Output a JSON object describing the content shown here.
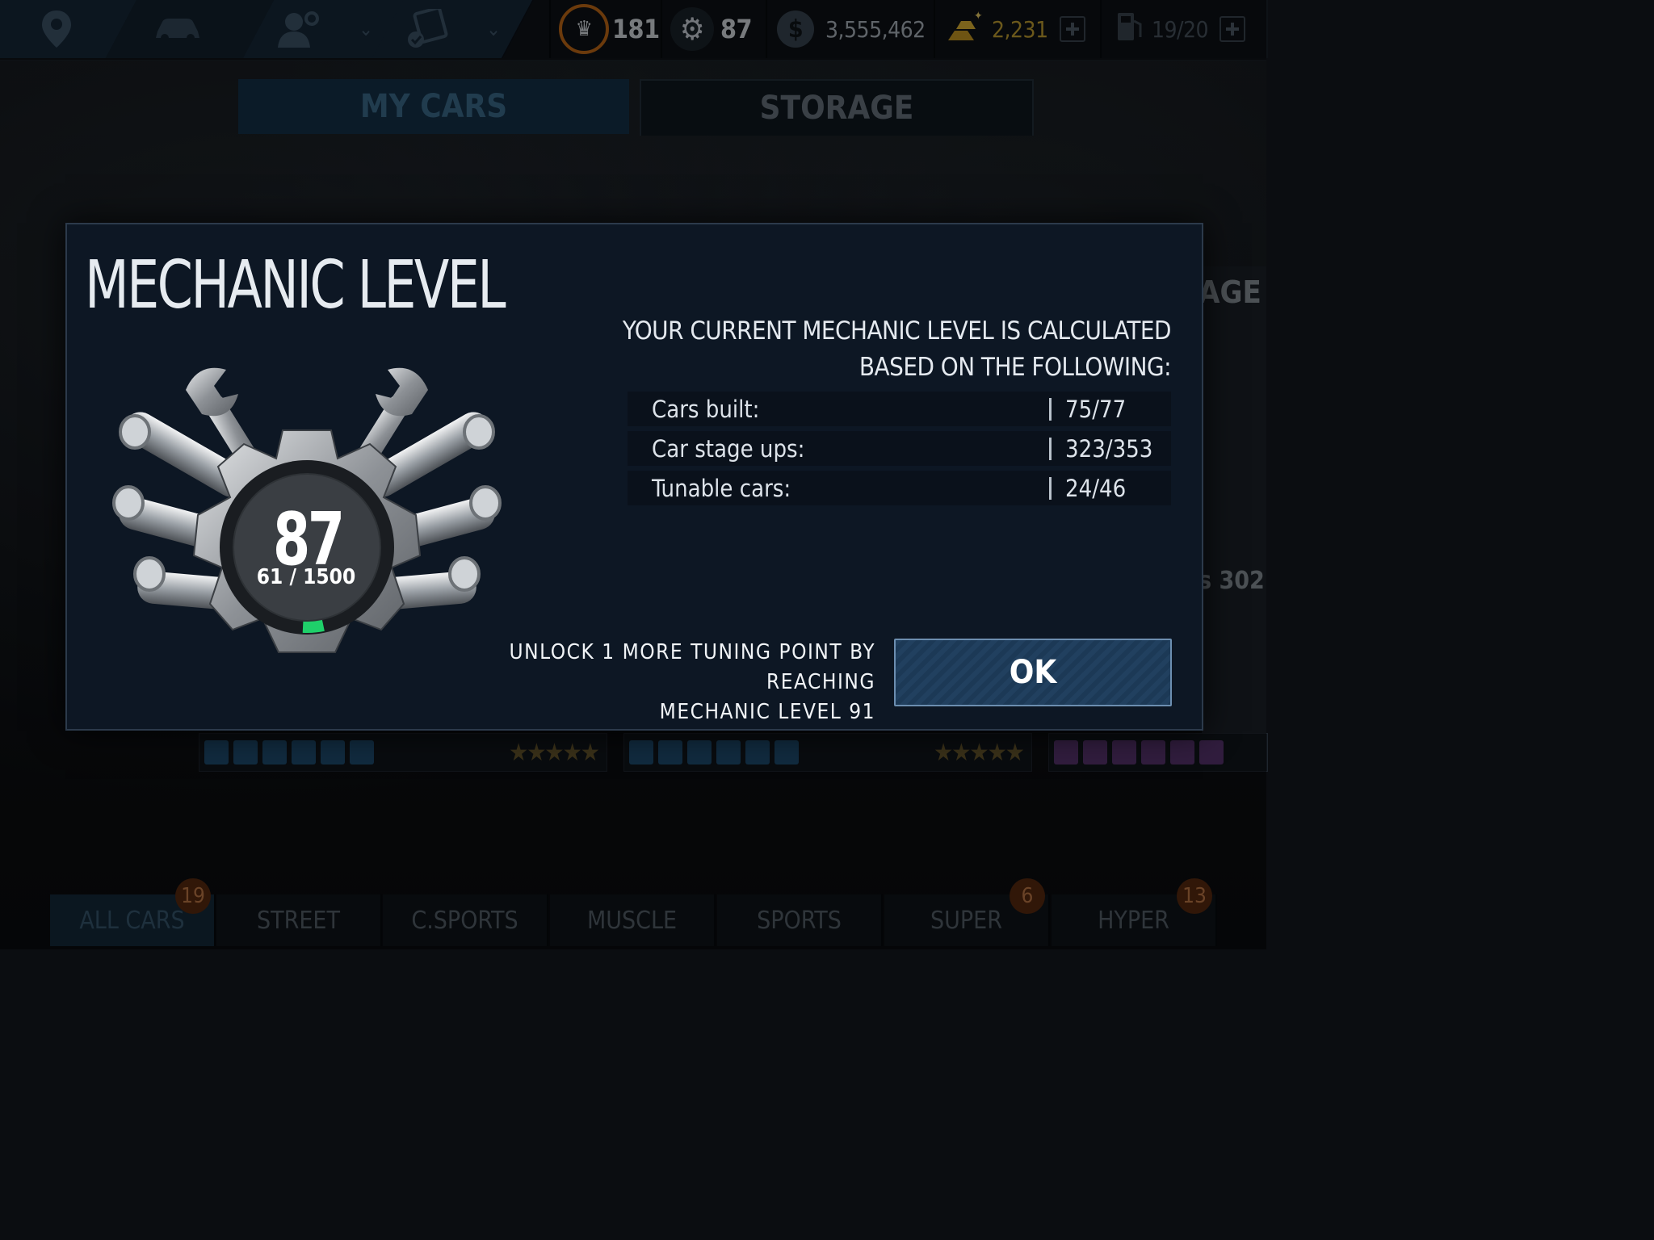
{
  "topbar": {
    "crown": "181",
    "gear_level": "87",
    "cash": "3,555,462",
    "gold": "2,231",
    "fuel": "19/20"
  },
  "tabs": {
    "my_cars": "MY CARS",
    "storage": "STORAGE"
  },
  "background": {
    "side_text_1": "AGE",
    "side_text_2": "s 302",
    "stars": "★★★★★"
  },
  "modal": {
    "title": "MECHANIC LEVEL",
    "description_line1": "YOUR CURRENT MECHANIC LEVEL IS CALCULATED",
    "description_line2": "BASED ON THE FOLLOWING:",
    "level": "87",
    "level_progress": "61 / 1500",
    "progress_fraction": 0.041,
    "rows": [
      {
        "label": "Cars built:",
        "value": "75/77"
      },
      {
        "label": "Car stage ups:",
        "value": "323/353"
      },
      {
        "label": "Tunable cars:",
        "value": "24/46"
      }
    ],
    "unlock_line1": "UNLOCK 1 MORE TUNING POINT BY REACHING",
    "unlock_line2": "MECHANIC LEVEL 91",
    "ok_label": "OK"
  },
  "categories": [
    {
      "label": "ALL CARS",
      "badge": "19"
    },
    {
      "label": "STREET",
      "badge": ""
    },
    {
      "label": "C.SPORTS",
      "badge": ""
    },
    {
      "label": "MUSCLE",
      "badge": ""
    },
    {
      "label": "SPORTS",
      "badge": ""
    },
    {
      "label": "SUPER",
      "badge": "6"
    },
    {
      "label": "HYPER",
      "badge": "13"
    }
  ],
  "colors": {
    "accent_blue": "#21405f",
    "gold": "#d8b43a",
    "progress_green": "#1fd06a"
  }
}
